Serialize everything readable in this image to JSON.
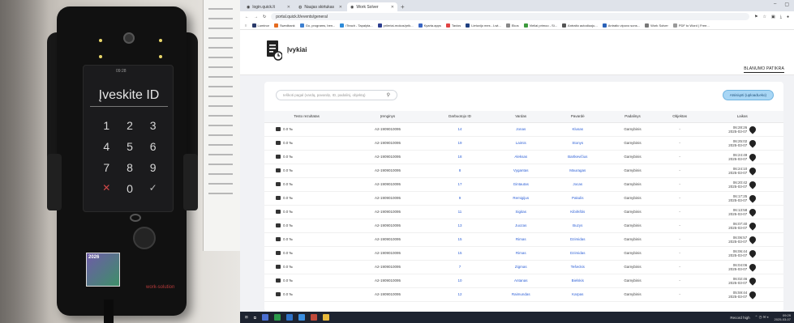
{
  "device": {
    "screen_title": "Įveskite ID",
    "status_time": "09:28",
    "keys": [
      "1",
      "2",
      "3",
      "4",
      "5",
      "6",
      "7",
      "8",
      "9",
      "✕",
      "0",
      "✓"
    ],
    "sticker_text": "2026",
    "brand_text": "work-solution"
  },
  "browser": {
    "tabs": [
      {
        "label": "login.quick.lt",
        "active": false
      },
      {
        "label": "Naujas skirtukas",
        "active": false
      },
      {
        "label": "Work Solver",
        "active": true
      }
    ],
    "new_tab": "+",
    "url": "portal.quick.lt/events/general",
    "bookmarks": [
      "Luminor",
      "Swedbank",
      "Go, programs, ben...",
      "iTeach - Tapalyta...",
      "prileriai-mokos/prik...",
      "Kyarta.apps",
      "Tavios",
      "Lietuvijo mes - Lwt...",
      "Ekos",
      "Vieliai primoo - Si...",
      "Antraito autodiuoju...",
      "Antraito vipovo sons...",
      "Work Solver",
      "PDF to Word | Free..."
    ]
  },
  "page": {
    "title": "Įvykiai",
    "header_link": "BLANUMO PATIKRA",
    "search_placeholder": "Ieškoti pagal (vardą, pavardę, ID, padalinį, objektą)",
    "new_button": "Atsisiųsti (uploadLeko)",
    "columns": [
      "Testo rezultatas",
      "Įrenginys",
      "Darbuotojo ID",
      "Vardas",
      "Pavardė",
      "Padalinys",
      "Objektas",
      "Laikas"
    ],
    "rows": [
      {
        "result": "0.0 ‰",
        "device": "A2-1909010095",
        "id": "14",
        "first": "Jonas",
        "last": "Klusas",
        "dept": "Gamybinis",
        "obj": "-",
        "time": "06:28:26",
        "date": "2025-03-07"
      },
      {
        "result": "0.0 ‰",
        "device": "A2-1909010095",
        "id": "19",
        "first": "Laimis",
        "last": "Stonys",
        "dept": "Gamybinis",
        "obj": "-",
        "time": "06:25:02",
        "date": "2025-03-07"
      },
      {
        "result": "0.0 ‰",
        "device": "A2-1909010095",
        "id": "18",
        "first": "Aleksas",
        "last": "Bartkevičius",
        "dept": "Gamybinis",
        "obj": "-",
        "time": "06:24:49",
        "date": "2025-03-07"
      },
      {
        "result": "0.0 ‰",
        "device": "A2-1909010095",
        "id": "8",
        "first": "Vygantas",
        "last": "Mauragas",
        "dept": "Gamybinis",
        "obj": "-",
        "time": "06:24:10",
        "date": "2025-03-07"
      },
      {
        "result": "0.0 ‰",
        "device": "A2-1909010095",
        "id": "17",
        "first": "Gintautas",
        "last": "Jocas",
        "dept": "Gamybinis",
        "obj": "-",
        "time": "06:20:42",
        "date": "2025-03-07"
      },
      {
        "result": "0.0 ‰",
        "device": "A2-1909010095",
        "id": "9",
        "first": "Remigijus",
        "last": "Pakulis",
        "dept": "Gamybinis",
        "obj": "-",
        "time": "06:17:25",
        "date": "2025-03-07"
      },
      {
        "result": "0.0 ‰",
        "device": "A2-1909010095",
        "id": "11",
        "first": "Sigitas",
        "last": "Kibirkštis",
        "dept": "Gamybinis",
        "obj": "-",
        "time": "06:13:58",
        "date": "2025-03-07"
      },
      {
        "result": "0.0 ‰",
        "device": "A2-1909010095",
        "id": "13",
        "first": "Juozas",
        "last": "Buzys",
        "dept": "Gamybinis",
        "obj": "-",
        "time": "06:07:40",
        "date": "2025-03-07"
      },
      {
        "result": "0.0 ‰",
        "device": "A2-1909010095",
        "id": "15",
        "first": "Rimas",
        "last": "Dzimidas",
        "dept": "Gamybinis",
        "obj": "-",
        "time": "06:06:57",
        "date": "2025-03-07"
      },
      {
        "result": "0.0 ‰",
        "device": "A2-1909010095",
        "id": "15",
        "first": "Rimas",
        "last": "Dzimidas",
        "dept": "Gamybinis",
        "obj": "-",
        "time": "06:06:44",
        "date": "2025-03-07"
      },
      {
        "result": "0.0 ‰",
        "device": "A2-1909010095",
        "id": "7",
        "first": "Zigmas",
        "last": "Tešeckis",
        "dept": "Gamybinis",
        "obj": "-",
        "time": "06:04:06",
        "date": "2025-03-07"
      },
      {
        "result": "0.0 ‰",
        "device": "A2-1909010095",
        "id": "10",
        "first": "Antanas",
        "last": "Bielskis",
        "dept": "Gamybinis",
        "obj": "-",
        "time": "06:02:46",
        "date": "2025-03-07"
      },
      {
        "result": "0.0 ‰",
        "device": "A2-1909010095",
        "id": "12",
        "first": "Raimundas",
        "last": "Karpas",
        "dept": "Gamybinis",
        "obj": "-",
        "time": "05:59:44",
        "date": "2025-03-07"
      }
    ]
  },
  "taskbar": {
    "status": "Record high",
    "clock_time": "09:29",
    "clock_date": "2025-03-07"
  },
  "colors": {
    "accent": "#2c5fd6",
    "button_bg": "#a8d6f5",
    "page_bg": "#f1f2f5"
  }
}
